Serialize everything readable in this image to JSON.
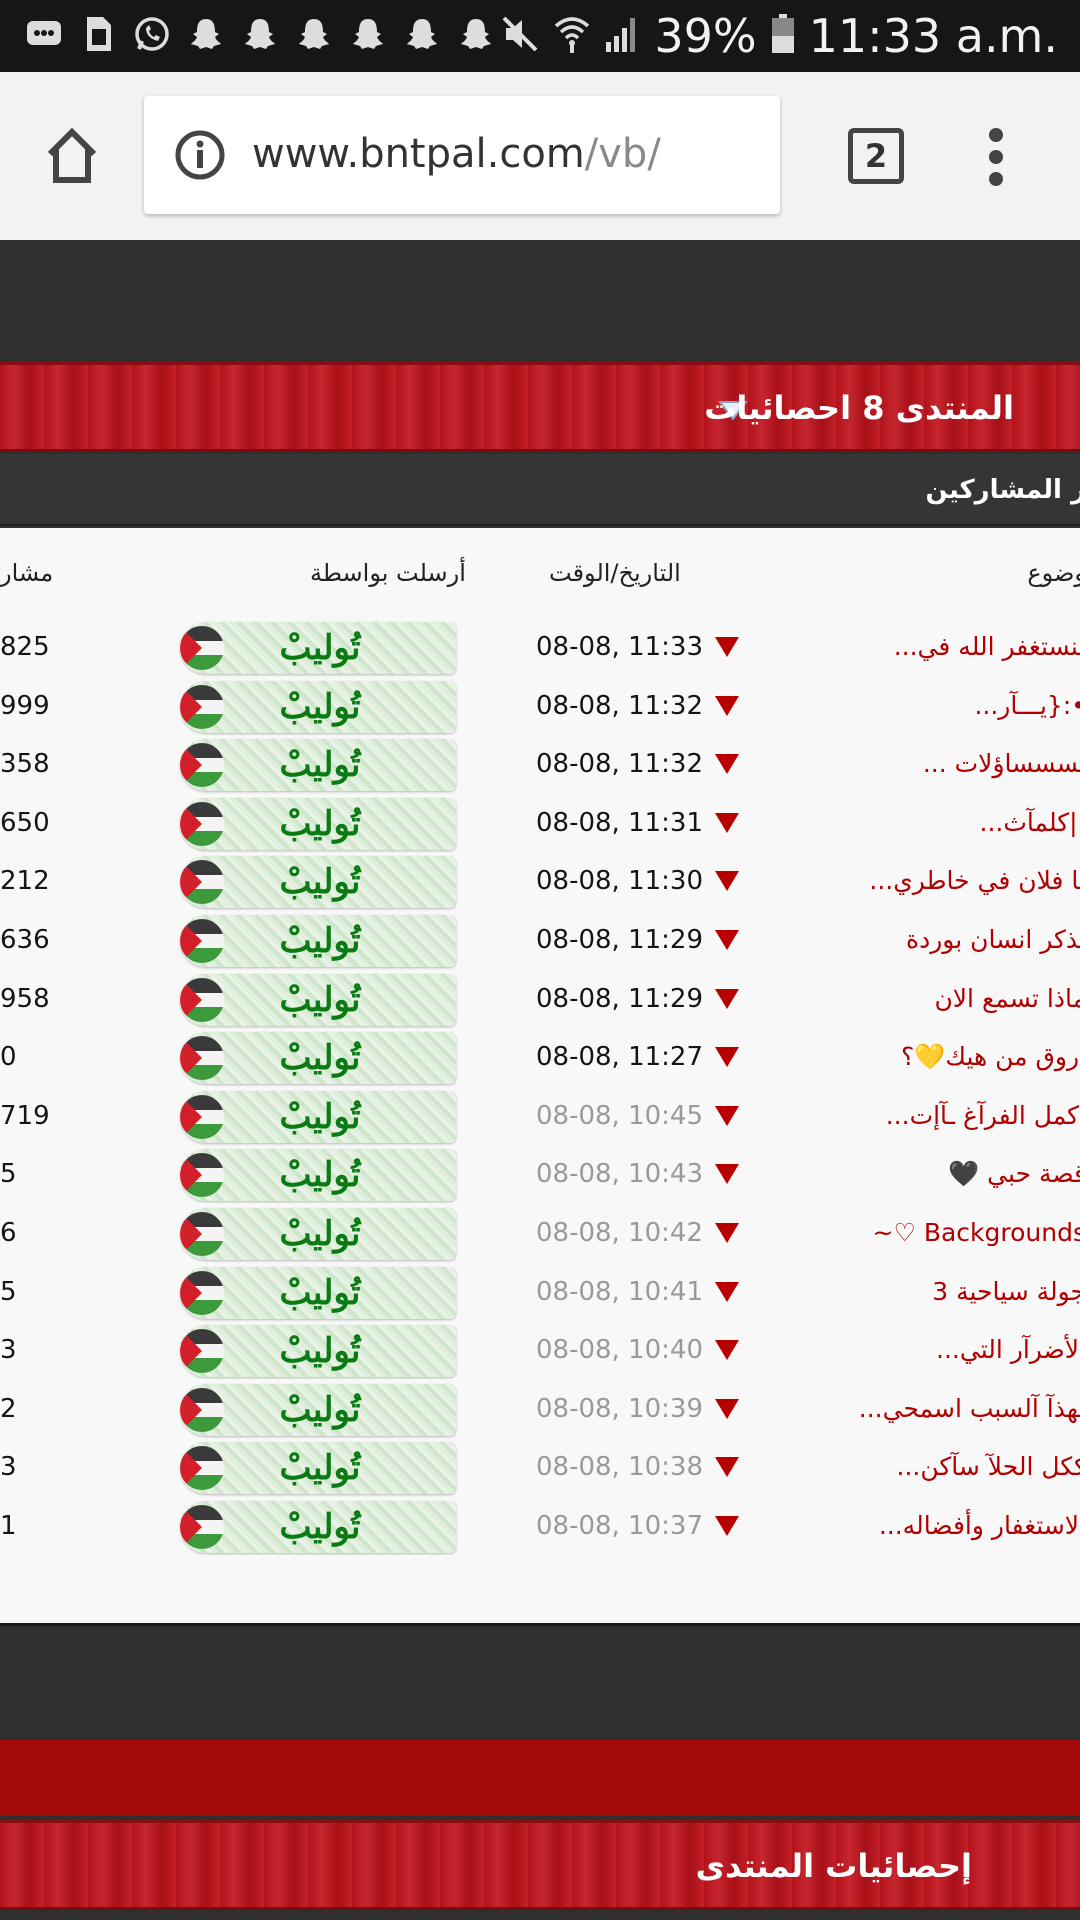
{
  "status_bar": {
    "battery": "39%",
    "time": "11:33 a.m."
  },
  "browser": {
    "url_domain": "www.bntpal.com",
    "url_path": "/vb/",
    "tab_count": "2"
  },
  "stats_section": {
    "title": "المنتدى 8 احصائيات",
    "sub_label": "ر المشاركين",
    "headers": {
      "topic": "وضوع",
      "date": "التاريخ/الوقت",
      "sender": "أرسلت بواسطة",
      "posts": "مشار"
    },
    "rows": [
      {
        "topic": "لنستغفر الله في...",
        "date": "08-08, 11:33",
        "sender": "تُوليبْ",
        "count": "825",
        "old": false
      },
      {
        "topic": "•:{يـــآر...",
        "date": "08-08, 11:32",
        "sender": "تُوليبْ",
        "count": "999",
        "old": false
      },
      {
        "topic": "تسسساؤلات ...",
        "date": "08-08, 11:32",
        "sender": "تُوليبْ",
        "count": "358",
        "old": false
      },
      {
        "topic": "||كلمآث...",
        "date": "08-08, 11:31",
        "sender": "تُوليبْ",
        "count": "650",
        "old": false
      },
      {
        "topic": "يا فلان في خاطري...",
        "date": "08-08, 11:30",
        "sender": "تُوليبْ",
        "count": "212",
        "old": false
      },
      {
        "topic": "تذكر انسان بوردة",
        "date": "08-08, 11:29",
        "sender": "تُوليبْ",
        "count": "636",
        "old": false
      },
      {
        "topic": "ماذا تسمع الان",
        "date": "08-08, 11:29",
        "sender": "تُوليبْ",
        "count": "958",
        "old": false
      },
      {
        "topic": "اروق من هيك💛؟",
        "date": "08-08, 11:27",
        "sender": "تُوليبْ",
        "count": "0",
        "old": false
      },
      {
        "topic": "أكمل الفرآغ ـآإت...",
        "date": "08-08, 10:45",
        "sender": "تُوليبْ",
        "count": "719",
        "old": true
      },
      {
        "topic": "قصة حبي 🖤",
        "date": "08-08, 10:43",
        "sender": "تُوليبْ",
        "count": "5",
        "old": true
      },
      {
        "topic": "Backgrounds ♡~",
        "date": "08-08, 10:42",
        "sender": "تُوليبْ",
        "count": "6",
        "old": true
      },
      {
        "topic": "جولة سياحية 3",
        "date": "08-08, 10:41",
        "sender": "تُوليبْ",
        "count": "5",
        "old": true
      },
      {
        "topic": "الأضرآر التي...",
        "date": "08-08, 10:40",
        "sender": "تُوليبْ",
        "count": "3",
        "old": true
      },
      {
        "topic": "لهذآ آلسبب اسمحي...",
        "date": "08-08, 10:39",
        "sender": "تُوليبْ",
        "count": "2",
        "old": true
      },
      {
        "topic": "ككل الحلآ سآكن...",
        "date": "08-08, 10:38",
        "sender": "تُوليبْ",
        "count": "3",
        "old": true
      },
      {
        "topic": "الاستغفار وأفضاله...",
        "date": "08-08, 10:37",
        "sender": "تُوليبْ",
        "count": "1",
        "old": true
      }
    ]
  },
  "forum_stats": {
    "title": "إحصائيات المنتدى"
  },
  "colors": {
    "accent_red": "#b3121b",
    "topic_red": "#b00000",
    "sender_green": "#0a7a12"
  }
}
